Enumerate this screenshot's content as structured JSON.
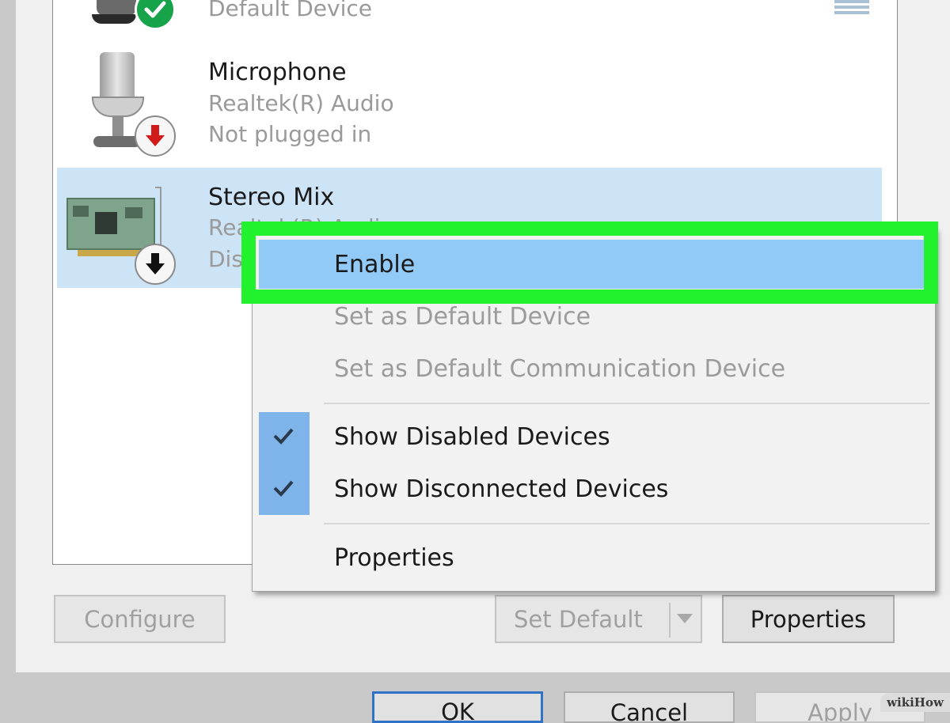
{
  "devices": [
    {
      "name": "",
      "status_line": "Default Device",
      "icon": "speaker-icon",
      "badge": "green-check-icon"
    },
    {
      "name": "Microphone",
      "driver": "Realtek(R) Audio",
      "status": "Not plugged in",
      "icon": "microphone-icon",
      "badge": "red-down-arrow-icon"
    },
    {
      "name": "Stereo Mix",
      "driver_partial": "Realtek(R) Audio",
      "status_partial": "Dis",
      "icon": "sound-card-icon",
      "badge": "black-down-arrow-icon",
      "selected": true
    }
  ],
  "buttons": {
    "configure": "Configure",
    "set_default": "Set Default",
    "properties": "Properties",
    "ok": "OK",
    "cancel": "Cancel",
    "apply": "Apply"
  },
  "context_menu": {
    "items": [
      {
        "label": "Enable",
        "enabled": true,
        "highlighted": true
      },
      {
        "label": "Set as Default Device",
        "enabled": false
      },
      {
        "label": "Set as Default Communication Device",
        "enabled": false
      },
      {
        "label": "Show Disabled Devices",
        "enabled": true,
        "checked": true
      },
      {
        "label": "Show Disconnected Devices",
        "enabled": true,
        "checked": true
      },
      {
        "label": "Properties",
        "enabled": true
      }
    ]
  },
  "watermark": "wikiHow",
  "colors": {
    "highlight_box": "#22f22e",
    "menu_hover": "#91c9f7",
    "selected_row": "#cde3f6",
    "check_strip": "#7eb4ea"
  }
}
